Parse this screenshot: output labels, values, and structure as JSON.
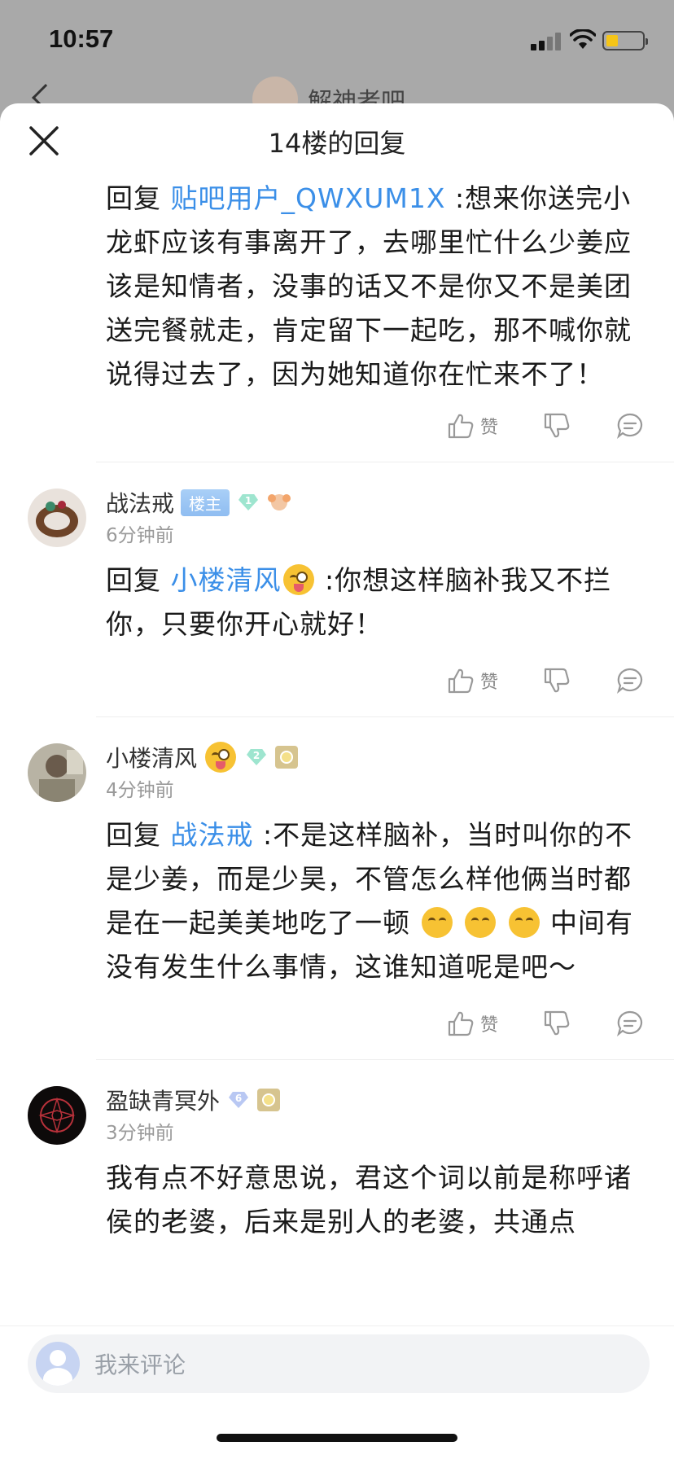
{
  "status_bar": {
    "time": "10:57"
  },
  "background_page": {
    "title": "解神者吧"
  },
  "sheet": {
    "title": "14楼的回复",
    "reply_prefix": "回复",
    "like_label": "赞"
  },
  "replies": [
    {
      "mention": "贴吧用户_QWXUM1X",
      "text": ":想来你送完小龙虾应该有事离开了，去哪里忙什么少姜应该是知情者，没事的话又不是你又不是美团送完餐就走，肯定留下一起吃，那不喊你就说得过去了，因为她知道你在忙来不了！"
    },
    {
      "author": "战法戒",
      "host_badge": "楼主",
      "gem_level": "1",
      "time_ago": "6分钟前",
      "mention": "小楼清风",
      "text": ":你想这样脑补我又不拦你，只要你开心就好！"
    },
    {
      "author": "小楼清风",
      "gem_level": "2",
      "time_ago": "4分钟前",
      "mention": "战法戒",
      "text_a": ":不是这样脑补，当时叫你的不是少姜，而是少昊，不管怎么样他俩当时都是在一起美美地吃了一顿",
      "text_b": "中间有没有发生什么事情，这谁知道呢是吧～"
    },
    {
      "author": "盈缺青冥外",
      "gem_level": "6",
      "time_ago": "3分钟前",
      "text": "我有点不好意思说，君这个词以前是称呼诸侯的老婆，后来是别人的老婆，共通点"
    }
  ],
  "comment_bar": {
    "placeholder": "我来评论"
  },
  "colors": {
    "mention": "#3b8fe8",
    "host_badge": "#a9cff7"
  }
}
